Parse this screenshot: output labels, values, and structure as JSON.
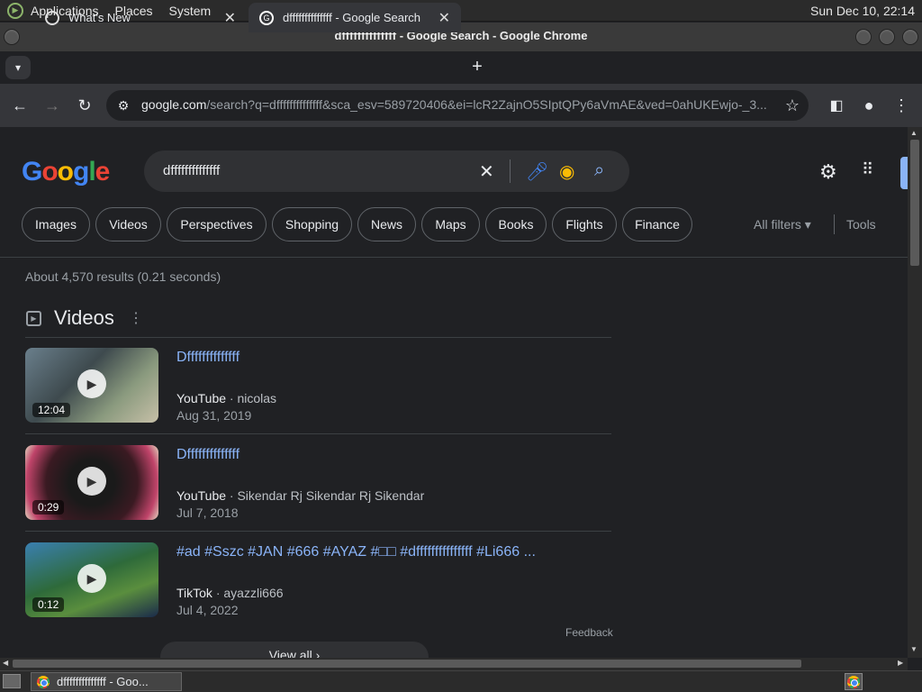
{
  "system_panel": {
    "menus": [
      "Applications",
      "Places",
      "System"
    ],
    "clock": "Sun Dec 10, 22:14"
  },
  "window": {
    "title": "dffffffffffffff - Google Search - Google Chrome"
  },
  "tabs": [
    {
      "label": "What's New",
      "active": false
    },
    {
      "label": "dffffffffffffff - Google Search",
      "active": true
    }
  ],
  "toolbar": {
    "url_host": "google.com",
    "url_rest": "/search?q=dffffffffffffff&sca_esv=589720406&ei=lcR2ZajnO5SIptQPy6aVmAE&ved=0ahUKEwjo-_3..."
  },
  "search": {
    "logo": "Google",
    "query": "dffffffffffffff",
    "filters": [
      "Images",
      "Videos",
      "Perspectives",
      "Shopping",
      "News",
      "Maps",
      "Books",
      "Flights",
      "Finance"
    ],
    "all_filters": "All filters",
    "tools": "Tools",
    "stats": "About 4,570 results (0.21 seconds)"
  },
  "videos": {
    "section_title": "Videos",
    "items": [
      {
        "title": "Dffffffffffffff",
        "source": "YouTube",
        "author": "nicolas",
        "date": "Aug 31, 2019",
        "duration": "12:04"
      },
      {
        "title": "Dffffffffffffff",
        "source": "YouTube",
        "author": "Sikendar Rj Sikendar Rj Sikendar",
        "date": "Jul 7, 2018",
        "duration": "0:29"
      },
      {
        "title": "#ad #Sszc #JAN #666 #AYAZ #□□ #dfffffffffffffff #Li666 ...",
        "source": "TikTok",
        "author": "ayazzli666",
        "date": "Jul 4, 2022",
        "duration": "0:12"
      }
    ],
    "feedback": "Feedback",
    "view_all": "View all"
  },
  "taskbar": {
    "window_label": "dffffffffffffff - Goo..."
  },
  "colors": {
    "link": "#8ab4f8",
    "background": "#202124",
    "accent_blue": "#4285f4"
  }
}
